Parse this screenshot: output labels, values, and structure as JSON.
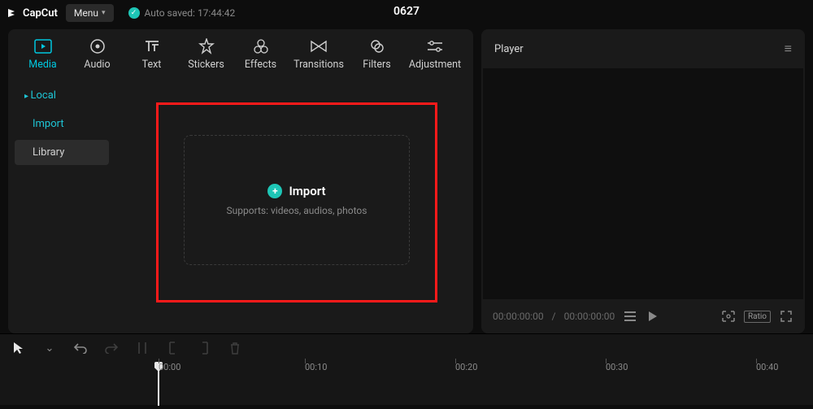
{
  "app": {
    "name": "CapCut"
  },
  "topbar": {
    "menu_label": "Menu",
    "autosave_label": "Auto saved: 17:44:42",
    "project_title": "0627"
  },
  "tooltabs": [
    {
      "label": "Media",
      "name": "tab-media",
      "active": true
    },
    {
      "label": "Audio",
      "name": "tab-audio",
      "active": false
    },
    {
      "label": "Text",
      "name": "tab-text",
      "active": false
    },
    {
      "label": "Stickers",
      "name": "tab-stickers",
      "active": false
    },
    {
      "label": "Effects",
      "name": "tab-effects",
      "active": false
    },
    {
      "label": "Transitions",
      "name": "tab-transitions",
      "active": false
    },
    {
      "label": "Filters",
      "name": "tab-filters",
      "active": false
    },
    {
      "label": "Adjustment",
      "name": "tab-adjustment",
      "active": false
    }
  ],
  "sidebar": {
    "local_label": "Local",
    "import_label": "Import",
    "library_label": "Library"
  },
  "dropzone": {
    "title": "Import",
    "subtitle": "Supports: videos, audios, photos"
  },
  "player": {
    "title": "Player",
    "time_current": "00:00:00:00",
    "time_total": "00:00:00:00",
    "ratio_label": "Ratio"
  },
  "timeline": {
    "ticks": [
      "00:00",
      "00:10",
      "00:20",
      "00:30",
      "00:40"
    ]
  }
}
